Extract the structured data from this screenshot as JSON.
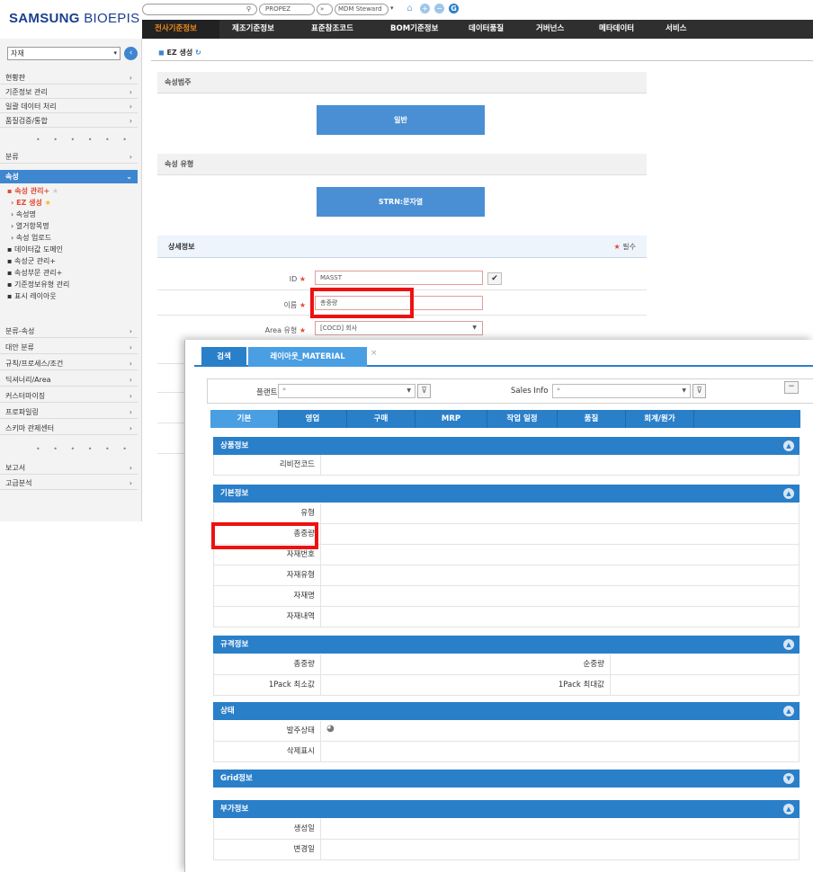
{
  "header": {
    "logo_bold": "SAMSUNG",
    "logo_light": "BIOEPIS",
    "topbar": {
      "search_icon": "search-icon",
      "propez": "PROPEZ",
      "role": "MDM Steward",
      "icons": [
        "home-icon",
        "plus-circle-icon",
        "minus-circle-icon",
        "logout-icon"
      ]
    },
    "nav": [
      "전사기준정보",
      "제조기준정보",
      "표준참조코드",
      "BOM기준정보",
      "데이터품질",
      "거버넌스",
      "메타데이터",
      "서비스"
    ]
  },
  "sidebar": {
    "select_value": "자재",
    "groups_top": [
      "현황판",
      "기준정보 관리",
      "일괄 데이터 처리",
      "품질검증/통합"
    ],
    "dots": "• • • • • •",
    "category": "분류",
    "attr_header": "속성",
    "attr_items": [
      {
        "label": "속성 관리+",
        "style": "red"
      },
      {
        "label": "EZ 생성",
        "style": "red-sub"
      },
      {
        "label": "속성명",
        "style": "sub"
      },
      {
        "label": "열거항목명",
        "style": "sub"
      },
      {
        "label": "속성 업로드",
        "style": "sub"
      },
      {
        "label": "데이터값 도메인",
        "style": "bullet"
      },
      {
        "label": "속성군 관리+",
        "style": "bullet"
      },
      {
        "label": "속성부문 관리+",
        "style": "bullet"
      },
      {
        "label": "기준정보유형 관리",
        "style": "bullet"
      },
      {
        "label": "표시 레이아웃",
        "style": "bullet"
      }
    ],
    "groups_bottom": [
      "분류-속성",
      "대안 분류",
      "규칙/프로세스/조건",
      "딕셔너리/Area",
      "커스터마이징",
      "프로파일링",
      "스키마 관제센터"
    ],
    "groups_last": [
      "보고서",
      "고급분석"
    ]
  },
  "main": {
    "crumb_title": "EZ 생성",
    "section_category": "속성범주",
    "btn_general": "일반",
    "section_type": "속성 유형",
    "btn_strn": "STRN:문자열",
    "detail_title": "상세정보",
    "required_note": "필수",
    "fields": {
      "id_label": "ID",
      "id_value": "MASST",
      "name_label": "이름",
      "name_value": "총중량",
      "area_label": "Area 유형",
      "area_value": "[COCD] 회사"
    }
  },
  "popup": {
    "tabs": [
      "검색",
      "레이아웃_MATERIAL"
    ],
    "close_char": "×",
    "filter": {
      "plant_label": "플랜트",
      "plant_value": "*",
      "sales_label": "Sales Info",
      "sales_value": "*"
    },
    "subtabs": [
      "기본",
      "영업",
      "구매",
      "MRP",
      "작업 일정",
      "품질",
      "회계/원가"
    ],
    "panels": {
      "product": {
        "title": "상품정보",
        "rows": [
          "리비전코드"
        ]
      },
      "basic": {
        "title": "기본정보",
        "rows": [
          "유형",
          "총중량",
          "자재번호",
          "자재유형",
          "자재명",
          "자재내역"
        ]
      },
      "spec": {
        "title": "규격정보",
        "rows": [
          [
            "총중량",
            "순중량"
          ],
          [
            "1Pack 최소값",
            "1Pack 최대값"
          ]
        ]
      },
      "status": {
        "title": "상태",
        "rows": [
          "발주상태",
          "삭제표시"
        ]
      },
      "grid": {
        "title": "Grid정보"
      },
      "extra": {
        "title": "부가정보",
        "rows": [
          "생성일",
          "변경일"
        ]
      }
    }
  },
  "colors": {
    "accent_blue": "#2a7fc9",
    "highlight_red": "#ee1111",
    "nav_active": "#f58a1f"
  }
}
